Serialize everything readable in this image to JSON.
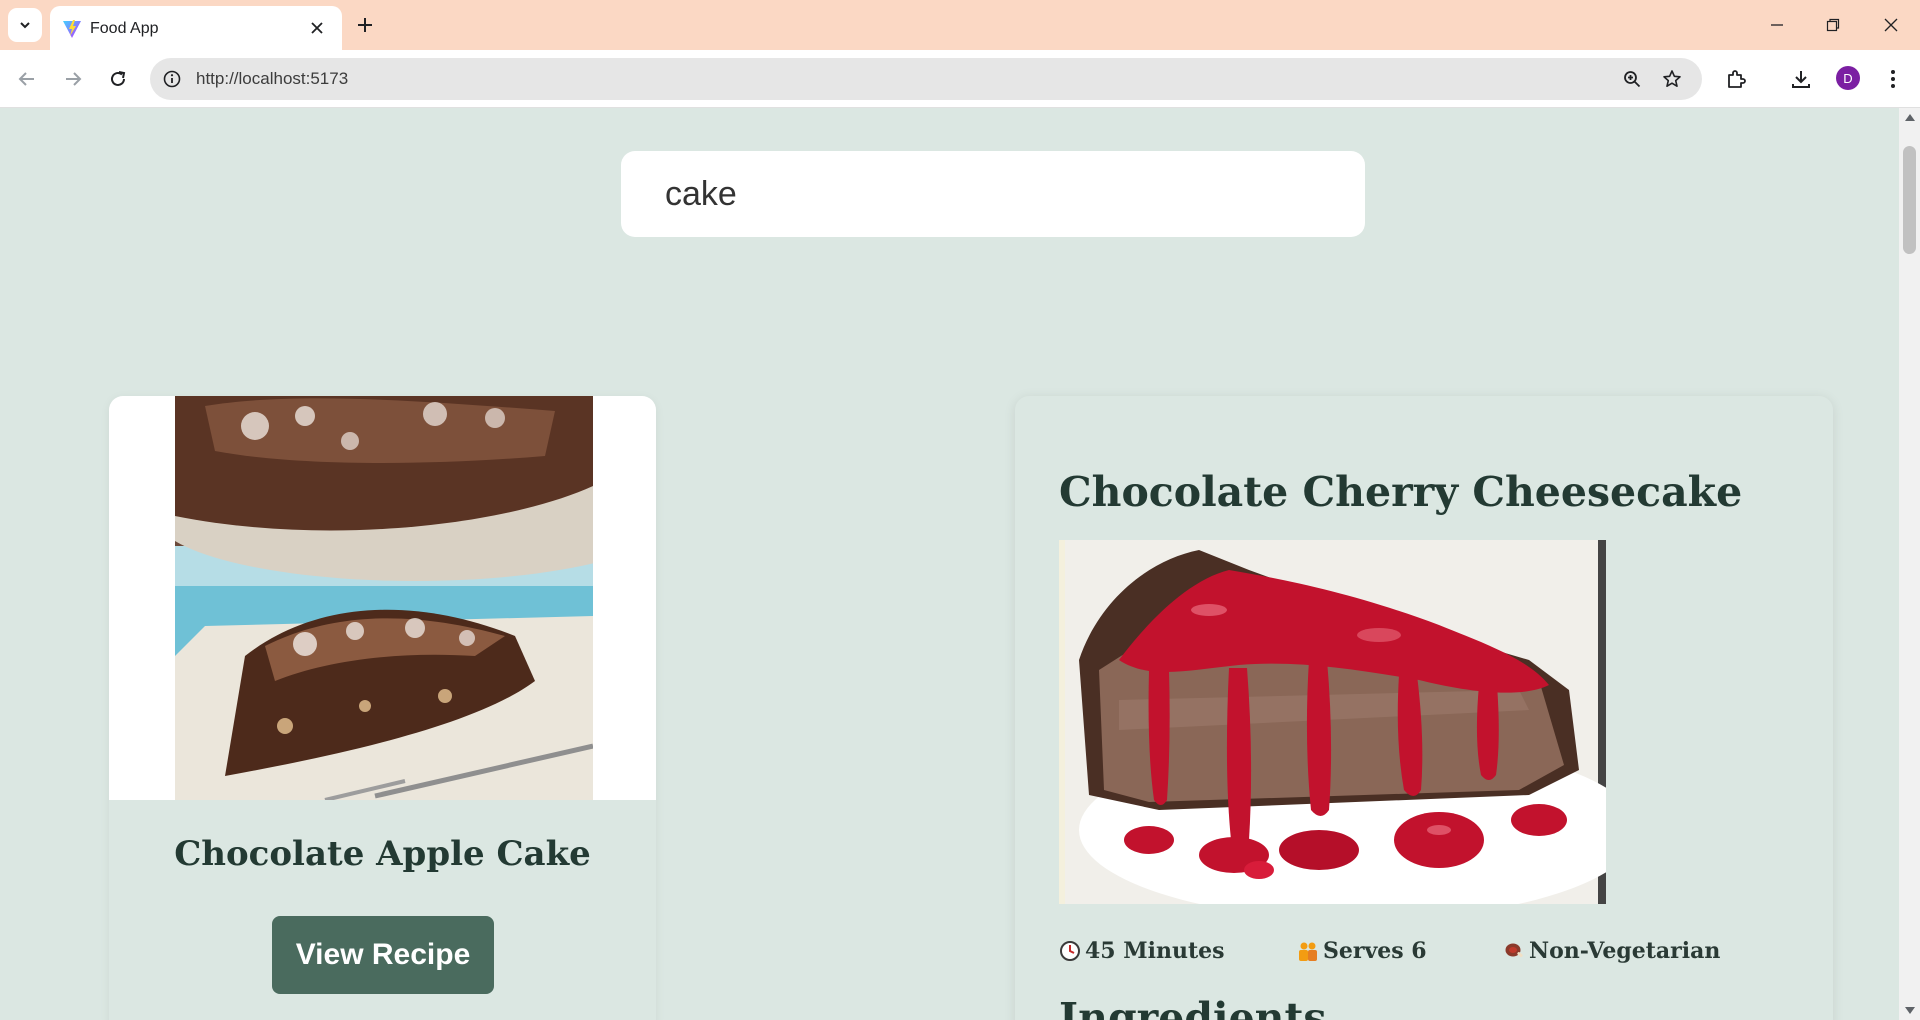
{
  "browser": {
    "tab_title": "Food App",
    "url": "http://localhost:5173",
    "profile_initial": "D",
    "icons": {
      "tab_search": "chevron-down-icon",
      "favicon": "vite-logo-icon",
      "close_tab": "close-icon",
      "new_tab": "plus-icon",
      "back": "arrow-left-icon",
      "forward": "arrow-right-icon",
      "reload": "reload-icon",
      "site_info": "info-icon",
      "zoom": "zoom-icon",
      "bookmark": "star-icon",
      "extensions": "puzzle-icon",
      "downloads": "download-icon",
      "menu": "kebab-menu-icon",
      "minimize": "minimize-icon",
      "restore": "restore-icon",
      "close_window": "close-icon"
    }
  },
  "search": {
    "value": "cake"
  },
  "results": [
    {
      "title": "Chocolate Apple Cake",
      "button_label": "View Recipe"
    }
  ],
  "detail": {
    "title": "Chocolate Cherry Cheesecake",
    "time": "45 Minutes",
    "serves": "Serves 6",
    "diet": "Non-Vegetarian",
    "ingredients_heading": "Ingredients"
  },
  "colors": {
    "page_bg": "#dbe7e2",
    "tabbar_bg": "#fbd8c4",
    "button_bg": "#4a6b5e",
    "heading": "#233a33"
  }
}
